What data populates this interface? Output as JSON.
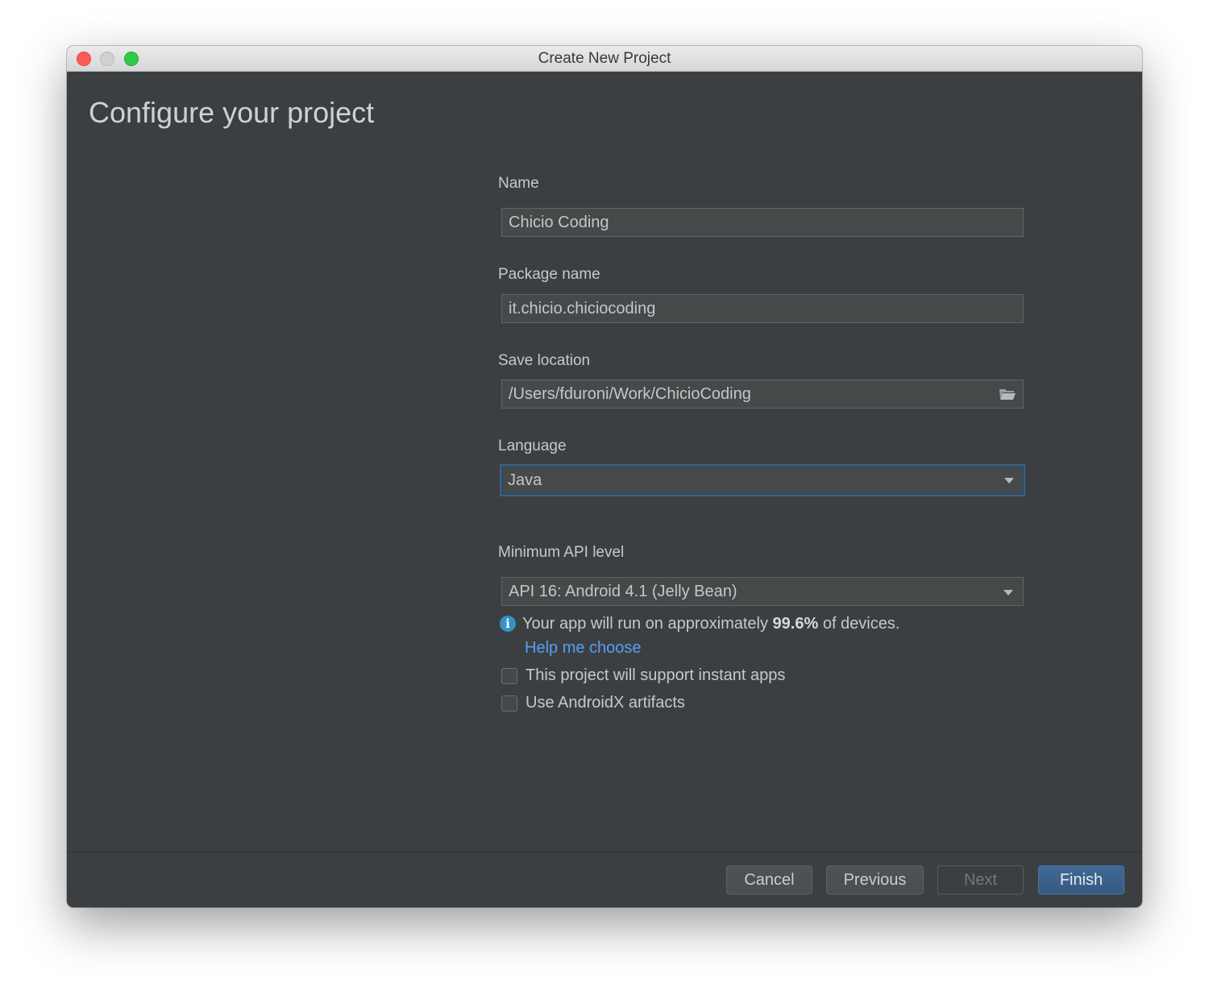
{
  "window": {
    "title": "Create New Project"
  },
  "page": {
    "heading": "Configure your project"
  },
  "form": {
    "name": {
      "label": "Name",
      "value": "Chicio Coding"
    },
    "package": {
      "label": "Package name",
      "value": "it.chicio.chiciocoding"
    },
    "save_location": {
      "label": "Save location",
      "value": "/Users/fduroni/Work/ChicioCoding",
      "icon": "folder-icon"
    },
    "language": {
      "label": "Language",
      "value": "Java"
    },
    "min_api": {
      "label": "Minimum API level",
      "value": "API 16: Android 4.1 (Jelly Bean)"
    },
    "info": {
      "icon": "info-icon",
      "prefix": "Your app will run on approximately ",
      "percent": "99.6%",
      "suffix": " of devices.",
      "link": "Help me choose"
    },
    "checkboxes": [
      {
        "label": "This project will support instant apps",
        "checked": false
      },
      {
        "label": "Use AndroidX artifacts",
        "checked": false
      }
    ]
  },
  "buttons": {
    "cancel": "Cancel",
    "previous": "Previous",
    "next": "Next",
    "finish": "Finish"
  },
  "colors": {
    "accent": "#589df6",
    "primary_button": "#3b6590",
    "background": "#3c3f41"
  }
}
